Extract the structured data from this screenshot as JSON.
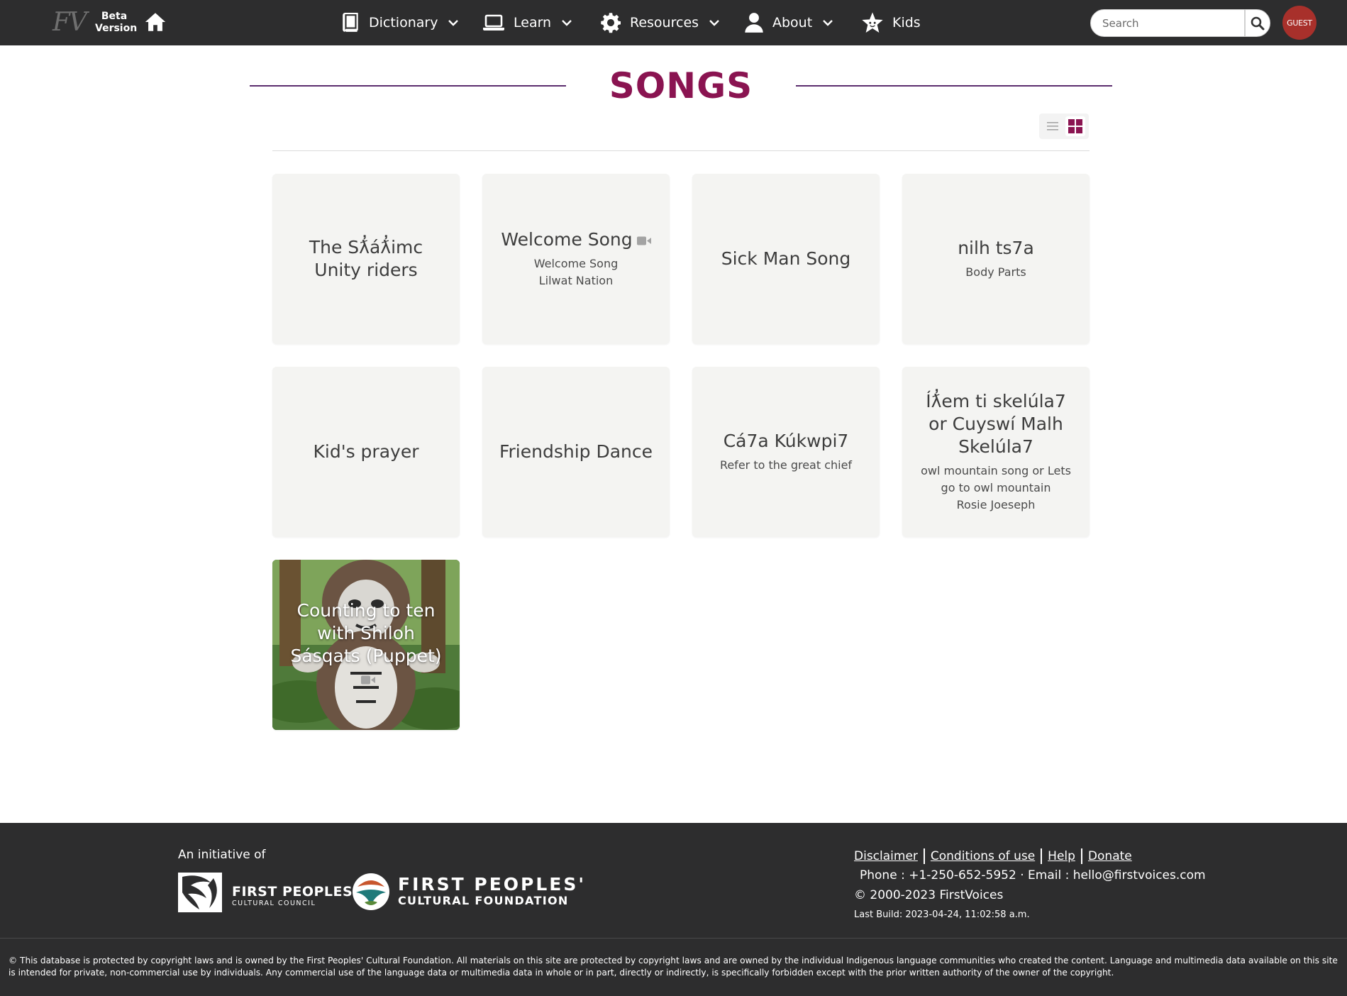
{
  "header": {
    "logo": "FV",
    "beta_label": "Beta Version",
    "nav": [
      {
        "label": "Dictionary",
        "icon": "book-icon",
        "has_dropdown": true
      },
      {
        "label": "Learn",
        "icon": "laptop-icon",
        "has_dropdown": true
      },
      {
        "label": "Resources",
        "icon": "gear-icon",
        "has_dropdown": true
      },
      {
        "label": "About",
        "icon": "person-icon",
        "has_dropdown": true
      },
      {
        "label": "Kids",
        "icon": "star-face-icon",
        "has_dropdown": false
      }
    ],
    "search_placeholder": "Search",
    "user_label": "GUEST"
  },
  "page": {
    "title": "SONGS",
    "view_mode": "grid"
  },
  "cards": [
    {
      "title": "The Sƛ̓áƛ̓imc Unity riders",
      "subtitle": "",
      "subtitle2": "",
      "has_video": false
    },
    {
      "title": "Welcome Song",
      "subtitle": "Welcome Song",
      "subtitle2": "Lilwat Nation",
      "has_video": true
    },
    {
      "title": "Sick Man Song",
      "subtitle": "",
      "subtitle2": "",
      "has_video": false
    },
    {
      "title": "nilh ts7a",
      "subtitle": "Body Parts",
      "subtitle2": "",
      "has_video": false
    },
    {
      "title": "Kid's prayer",
      "subtitle": "",
      "subtitle2": "",
      "has_video": false
    },
    {
      "title": "Friendship Dance",
      "subtitle": "",
      "subtitle2": "",
      "has_video": false
    },
    {
      "title": "Cá7a Kúkwpi7",
      "subtitle": "Refer to the great chief",
      "subtitle2": "",
      "has_video": false
    },
    {
      "title": "Íƛ̓em ti skelúla7 or Cuyswí Malh Skelúla7",
      "subtitle": "owl mountain song or Lets go to owl mountain",
      "subtitle2": "Rosie Joeseph",
      "has_video": false
    },
    {
      "title": "Counting to ten with Shiloh Sásqats (Puppet)",
      "subtitle": "",
      "subtitle2": "",
      "has_video": true,
      "has_image": true
    }
  ],
  "footer": {
    "initiative": "An initiative of",
    "org1_line1": "FIRST PEOPLES'",
    "org1_line2": "CULTURAL COUNCIL",
    "org2_line1": "FIRST PEOPLES'",
    "org2_line2": "CULTURAL FOUNDATION",
    "links": [
      "Disclaimer",
      "Conditions of use",
      "Help",
      "Donate"
    ],
    "contact": "Phone : +1-250-652-5952 · Email : hello@firstvoices.com",
    "copyright": "© 2000-2023 FirstVoices",
    "build": "Last Build: 2023-04-24, 11:02:58 a.m.",
    "legal": "© This database is protected by copyright laws and is owned by the First Peoples' Cultural Foundation. All materials on this site are protected by copyright laws and are owned by the individual Indigenous language communities who created the content. Language and multimedia data available on this site is intended for private, non-commercial use by individuals. Any commercial use of the language data or multimedia data in whole or in part, directly or indirectly, is specifically forbidden except with the prior written authority of the owner of the copyright."
  },
  "colors": {
    "nav_bg": "#2d2d2e",
    "title": "#8a1451",
    "accent_line": "#5b2d6e",
    "card_bg": "#f4f4f2",
    "guest_badge": "#a8302b"
  }
}
